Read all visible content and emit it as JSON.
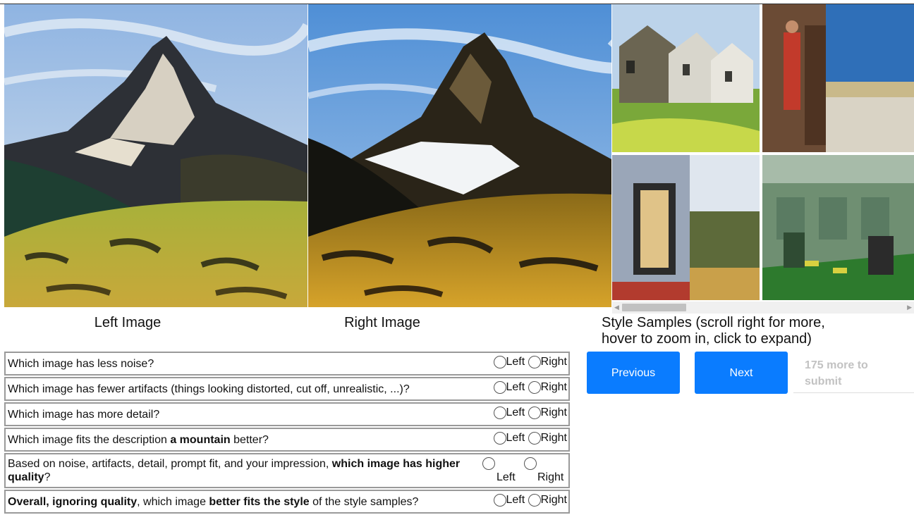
{
  "captions": {
    "left": "Left Image",
    "right": "Right Image",
    "samples_line1": "Style Samples (scroll right for more,",
    "samples_line2": "hover to zoom in, click to expand)"
  },
  "questions": [
    {
      "parts": [
        {
          "t": "Which image has less noise?",
          "b": false
        }
      ]
    },
    {
      "parts": [
        {
          "t": "Which image has fewer artifacts (things looking distorted, cut off, unrealistic, ...)?",
          "b": false
        }
      ]
    },
    {
      "parts": [
        {
          "t": "Which image has more detail?",
          "b": false
        }
      ]
    },
    {
      "parts": [
        {
          "t": "Which image fits the description ",
          "b": false
        },
        {
          "t": "a mountain",
          "b": true
        },
        {
          "t": " better?",
          "b": false
        }
      ]
    },
    {
      "parts": [
        {
          "t": "Based on noise, artifacts, detail, prompt fit, and your impression, ",
          "b": false
        },
        {
          "t": "which image has higher quality",
          "b": true
        },
        {
          "t": "?",
          "b": false
        }
      ]
    },
    {
      "parts": [
        {
          "t": "Overall, ignoring quality",
          "b": true
        },
        {
          "t": ", which image ",
          "b": false
        },
        {
          "t": "better fits the style",
          "b": true
        },
        {
          "t": " of the style samples?",
          "b": false
        }
      ]
    }
  ],
  "options": {
    "left": "Left",
    "right": "Right"
  },
  "buttons": {
    "previous": "Previous",
    "next": "Next"
  },
  "remaining": {
    "line1": "175 more to",
    "line2": "submit"
  },
  "colors": {
    "accent": "#0a7cff",
    "border": "#9a9a9a",
    "muted": "#c2c2c2"
  },
  "icons": {
    "scroll_left": "triangle-left",
    "scroll_right": "triangle-right"
  }
}
